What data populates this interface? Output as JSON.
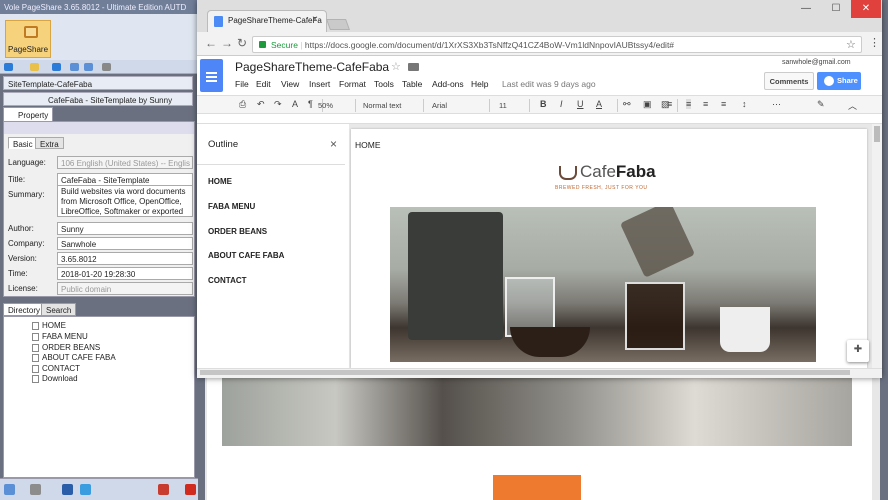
{
  "app": {
    "title": "Vole PageShare 3.65.8012 - Ultimate Edition AUTD",
    "ribbon_button": "PageShare"
  },
  "left_panel": {
    "template_bar": "SiteTemplate-CafeFaba",
    "theme_bar": "CafeFaba - SiteTemplate by Sunny",
    "property_tab": "Property",
    "tabs": [
      "Basic",
      "Extra"
    ],
    "fields": {
      "language": {
        "label": "Language:",
        "value": "106 English (United States) -- Englis"
      },
      "title": {
        "label": "Title:",
        "value": "CafeFaba - SiteTemplate"
      },
      "summary": {
        "label": "Summary:",
        "value": "Build websites via word documents from Microsoft Office, OpenOffice, LibreOffice, Softmaker or exported"
      },
      "author": {
        "label": "Author:",
        "value": "Sunny"
      },
      "company": {
        "label": "Company:",
        "value": "Sanwhole"
      },
      "version": {
        "label": "Version:",
        "value": "3.65.8012"
      },
      "time": {
        "label": "Time:",
        "value": "2018-01-20 19:28:30"
      },
      "license": {
        "label": "License:",
        "value": "Public domain"
      }
    },
    "dir_tabs": [
      "Directory",
      "Search"
    ],
    "directory": [
      "HOME",
      "FABA MENU",
      "ORDER BEANS",
      "ABOUT CAFE FABA",
      "CONTACT",
      "Download"
    ]
  },
  "browser": {
    "tab_title": "PageShareTheme-CafeFa",
    "secure_label": "Secure",
    "url": "https://docs.google.com/document/d/1XrXS3Xb3TsNffzQ41CZ4BoW-Vm1ldNnpovIAUBtssy4/edit#"
  },
  "docs": {
    "doc_title": "PageShareTheme-CafeFaba",
    "menu": [
      "File",
      "Edit",
      "View",
      "Insert",
      "Format",
      "Tools",
      "Table",
      "Add-ons",
      "Help"
    ],
    "last_edit": "Last edit was 9 days ago",
    "account": "sanwhole@gmail.com",
    "comments_label": "Comments",
    "share_label": "Share",
    "toolbar": {
      "zoom": "50%",
      "style": "Normal text",
      "font": "Arial",
      "size": "11"
    },
    "outline": {
      "title": "Outline",
      "items": [
        "HOME",
        "FABA MENU",
        "ORDER BEANS",
        "ABOUT CAFE FABA",
        "CONTACT"
      ]
    },
    "page": {
      "heading": "HOME",
      "logo_cafe": "Cafe",
      "logo_faba": "Faba",
      "logo_tagline": "BREWED FRESH, JUST FOR YOU"
    }
  },
  "colors": {
    "docs_blue": "#4f86f7",
    "share_blue": "#4d90fe",
    "secure_green": "#1c9a3c",
    "accent_orange": "#ee7a2f",
    "ribbon_orange": "#f7d27c"
  }
}
